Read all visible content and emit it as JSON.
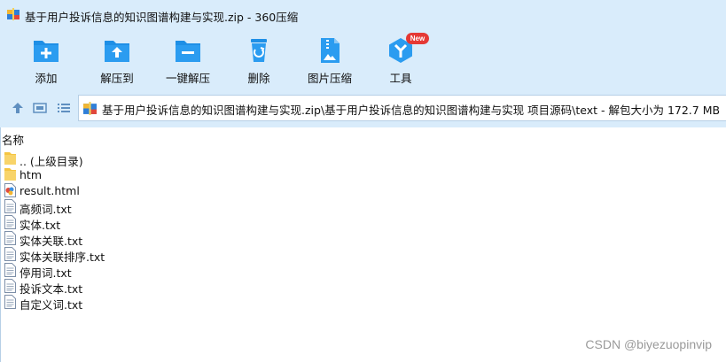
{
  "window": {
    "title": "基于用户投诉信息的知识图谱构建与实现.zip - 360压缩"
  },
  "toolbar": {
    "items": [
      {
        "label": "添加",
        "icon": "add-icon"
      },
      {
        "label": "解压到",
        "icon": "extract-to-icon"
      },
      {
        "label": "一键解压",
        "icon": "one-click-extract-icon"
      },
      {
        "label": "删除",
        "icon": "delete-icon"
      },
      {
        "label": "图片压缩",
        "icon": "image-compress-icon"
      },
      {
        "label": "工具",
        "icon": "tools-icon",
        "badge": "New"
      }
    ]
  },
  "address": {
    "path": "基于用户投诉信息的知识图谱构建与实现.zip\\基于用户投诉信息的知识图谱构建与实现 项目源码\\text - 解包大小为 172.7 MB"
  },
  "list": {
    "column_name": "名称",
    "files": [
      {
        "name": ".. (上级目录)",
        "type": "folder"
      },
      {
        "name": "htm",
        "type": "folder"
      },
      {
        "name": "result.html",
        "type": "html"
      },
      {
        "name": "高频词.txt",
        "type": "txt"
      },
      {
        "name": "实体.txt",
        "type": "txt"
      },
      {
        "name": "实体关联.txt",
        "type": "txt"
      },
      {
        "name": "实体关联排序.txt",
        "type": "txt"
      },
      {
        "name": "停用词.txt",
        "type": "txt"
      },
      {
        "name": "投诉文本.txt",
        "type": "txt"
      },
      {
        "name": "自定义词.txt",
        "type": "txt"
      }
    ]
  },
  "watermark": "CSDN @biyezuopinvip",
  "colors": {
    "chrome_bg": "#d9ecfb",
    "icon_blue": "#1e8fe6",
    "folder_yellow": "#f5c542",
    "badge_red": "#e53935"
  }
}
